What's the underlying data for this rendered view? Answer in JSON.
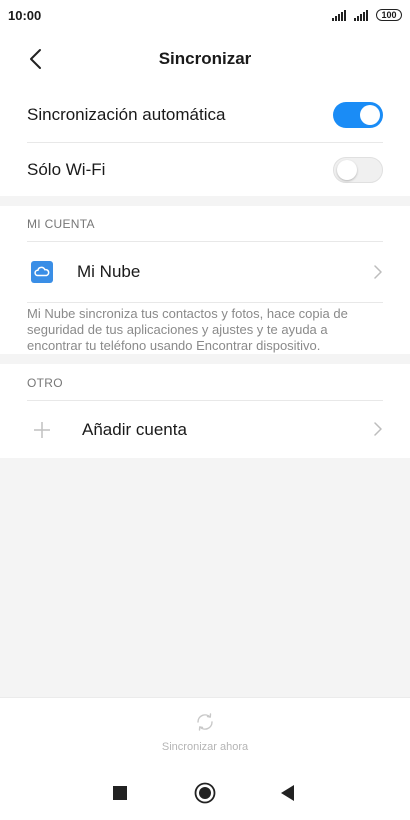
{
  "status_bar": {
    "time": "10:00",
    "battery": "100",
    "icons": [
      "signal-icon",
      "signal-icon",
      "battery-icon"
    ]
  },
  "header": {
    "title": "Sincronizar",
    "back_icon": "chevron-left-icon"
  },
  "sync_settings": {
    "auto_sync": {
      "label": "Sincronización automática",
      "enabled": true
    },
    "wifi_only": {
      "label": "Sólo Wi-Fi",
      "enabled": false
    }
  },
  "my_account": {
    "section_title": "MI CUENTA",
    "item": {
      "label": "Mi Nube",
      "icon": "cloud-icon"
    },
    "description": "Mi Nube sincroniza tus contactos y fotos, hace copia de seguridad de tus aplicaciones y ajustes y te ayuda a encontrar tu teléfono usando Encontrar dispositivo."
  },
  "other": {
    "section_title": "OTRO",
    "item": {
      "label": "Añadir cuenta",
      "icon": "plus-icon"
    }
  },
  "bottom_action": {
    "label": "Sincronizar ahora",
    "icon": "sync-icon"
  },
  "nav_bar": {
    "buttons": [
      "recents-icon",
      "home-icon",
      "back-icon"
    ]
  },
  "colors": {
    "accent": "#1a8cf6",
    "cloud_icon_bg": "#3a8ee6",
    "background": "#f4f4f4"
  }
}
